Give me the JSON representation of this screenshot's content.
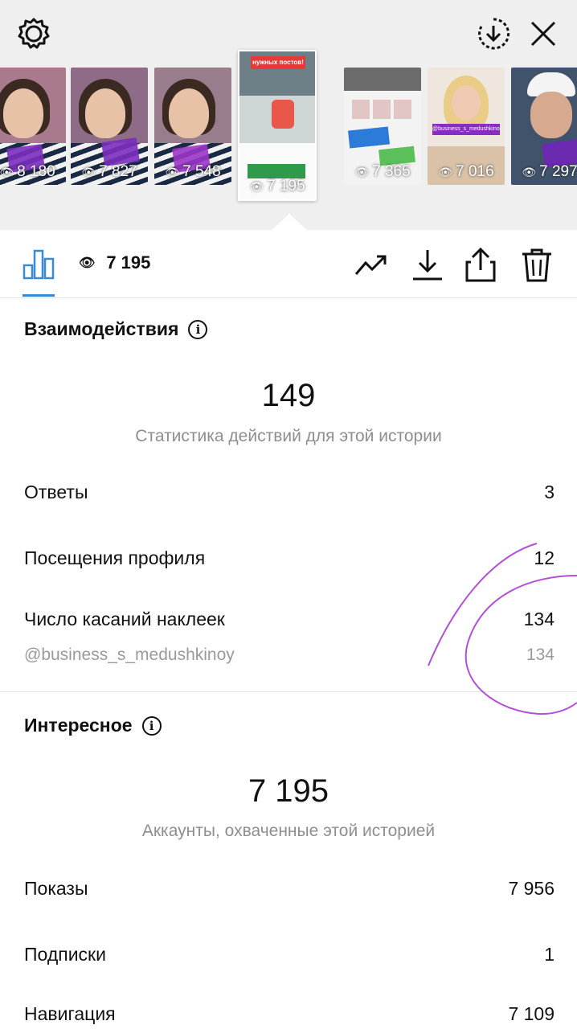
{
  "header": {
    "settings_icon": "gear-outline-icon",
    "save_icon": "download-circle-icon",
    "close_icon": "close-icon"
  },
  "stories": [
    {
      "views": "8 180",
      "active": false
    },
    {
      "views": "7 827",
      "active": false
    },
    {
      "views": "7 548",
      "active": false
    },
    {
      "views": "7 195",
      "active": true,
      "banner": "нужных постов!"
    },
    {
      "views": "7 365",
      "active": false
    },
    {
      "views": "7 016",
      "active": false,
      "sticker": "@business_s_medushkinoy"
    },
    {
      "views": "7 297",
      "active": false
    }
  ],
  "toolbar": {
    "views": "7 195",
    "icons": [
      "bar-chart-icon",
      "eye-icon",
      "trending-up-icon",
      "download-icon",
      "share-icon",
      "trash-icon"
    ]
  },
  "interactions": {
    "title": "Взаимодействия",
    "total": "149",
    "caption": "Статистика действий для этой истории",
    "rows": [
      {
        "label": "Ответы",
        "value": "3"
      },
      {
        "label": "Посещения профиля",
        "value": "12"
      },
      {
        "label": "Число касаний наклеек",
        "value": "134"
      }
    ],
    "sub_row": {
      "label": "@business_s_medushkinoy",
      "value": "134"
    }
  },
  "discovery": {
    "title": "Интересное",
    "total": "7 195",
    "caption": "Аккаунты, охваченные этой историей",
    "rows": [
      {
        "label": "Показы",
        "value": "7 956"
      },
      {
        "label": "Подписки",
        "value": "1"
      },
      {
        "label": "Навигация",
        "value": "7 109"
      }
    ]
  },
  "colors": {
    "accent": "#3b8ad6",
    "annotation": "#b24fd6",
    "sticker": "#7b2fbf",
    "muted": "#8e8e8e"
  }
}
